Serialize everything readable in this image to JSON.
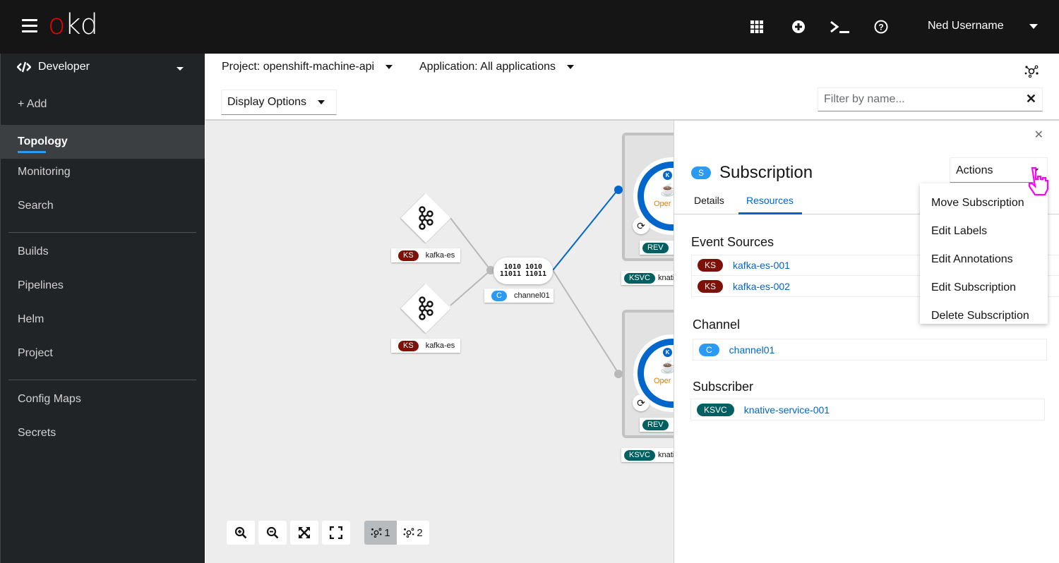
{
  "masthead": {
    "logo_prefix": "o",
    "logo_suffix": "kd",
    "icons": [
      "app-launcher-icon",
      "plus-circle-icon",
      "terminal-icon",
      "help-icon"
    ],
    "user_name": "Ned Username"
  },
  "sidebar": {
    "perspective": "Developer",
    "items": [
      {
        "label": "+ Add",
        "active": false
      },
      {
        "label": "Topology",
        "active": true
      },
      {
        "label": "Monitoring",
        "active": false
      },
      {
        "label": "Search",
        "active": false
      },
      {
        "label": "Builds",
        "active": false
      },
      {
        "label": "Pipelines",
        "active": false
      },
      {
        "label": "Helm",
        "active": false
      },
      {
        "label": "Project",
        "active": false
      },
      {
        "label": "Config Maps",
        "active": false
      },
      {
        "label": "Secrets",
        "active": false
      }
    ]
  },
  "toolbar": {
    "project_selector": "Project: openshift-machine-api",
    "application_selector": "Application: All applications",
    "display_options": "Display Options",
    "filter_placeholder": "Filter by name...",
    "filter_value": ""
  },
  "topology": {
    "event_sources": [
      {
        "badge": "KS",
        "name": "kafka-es"
      },
      {
        "badge": "KS",
        "name": "kafka-es"
      }
    ],
    "channel": {
      "badge": "C",
      "name": "channel01",
      "glyph_line1": "1010 1010",
      "glyph_line2": "11011 11011"
    },
    "services": [
      {
        "rev_badge": "REV",
        "rev_name": "R",
        "svc_badge": "KSVC",
        "svc_name": "knativ",
        "k_badge": "K",
        "runtime": "Oper"
      },
      {
        "rev_badge": "REV",
        "rev_name": "R",
        "svc_badge": "KSVC",
        "svc_name": "knativ",
        "k_badge": "K",
        "runtime": "Oper"
      }
    ],
    "zoom_controls": [
      "zoom-in-icon",
      "zoom-out-icon",
      "fit-to-screen-icon",
      "reset-view-icon"
    ],
    "layouts": [
      {
        "label": "1",
        "active": true
      },
      {
        "label": "2",
        "active": false
      }
    ],
    "colors": {
      "selected_edge": "#0066cc",
      "edge": "#b8b8b8"
    }
  },
  "side_panel": {
    "type_badge": "S",
    "title": "Subscription",
    "actions_label": "Actions",
    "tabs": [
      {
        "label": "Details",
        "active": false
      },
      {
        "label": "Resources",
        "active": true
      }
    ],
    "event_sources_title": "Event Sources",
    "event_sources": [
      {
        "badge": "KS",
        "name": "kafka-es-001"
      },
      {
        "badge": "KS",
        "name": "kafka-es-002"
      }
    ],
    "channel_title": "Channel",
    "channel": {
      "badge": "C",
      "name": "channel01"
    },
    "subscriber_title": "Subscriber",
    "subscriber": {
      "badge": "KSVC",
      "name": "knative-service-001"
    }
  },
  "actions_menu": [
    "Move Subscription",
    "Edit Labels",
    "Edit Annotations",
    "Edit Subscription",
    "Delete Subscription"
  ]
}
